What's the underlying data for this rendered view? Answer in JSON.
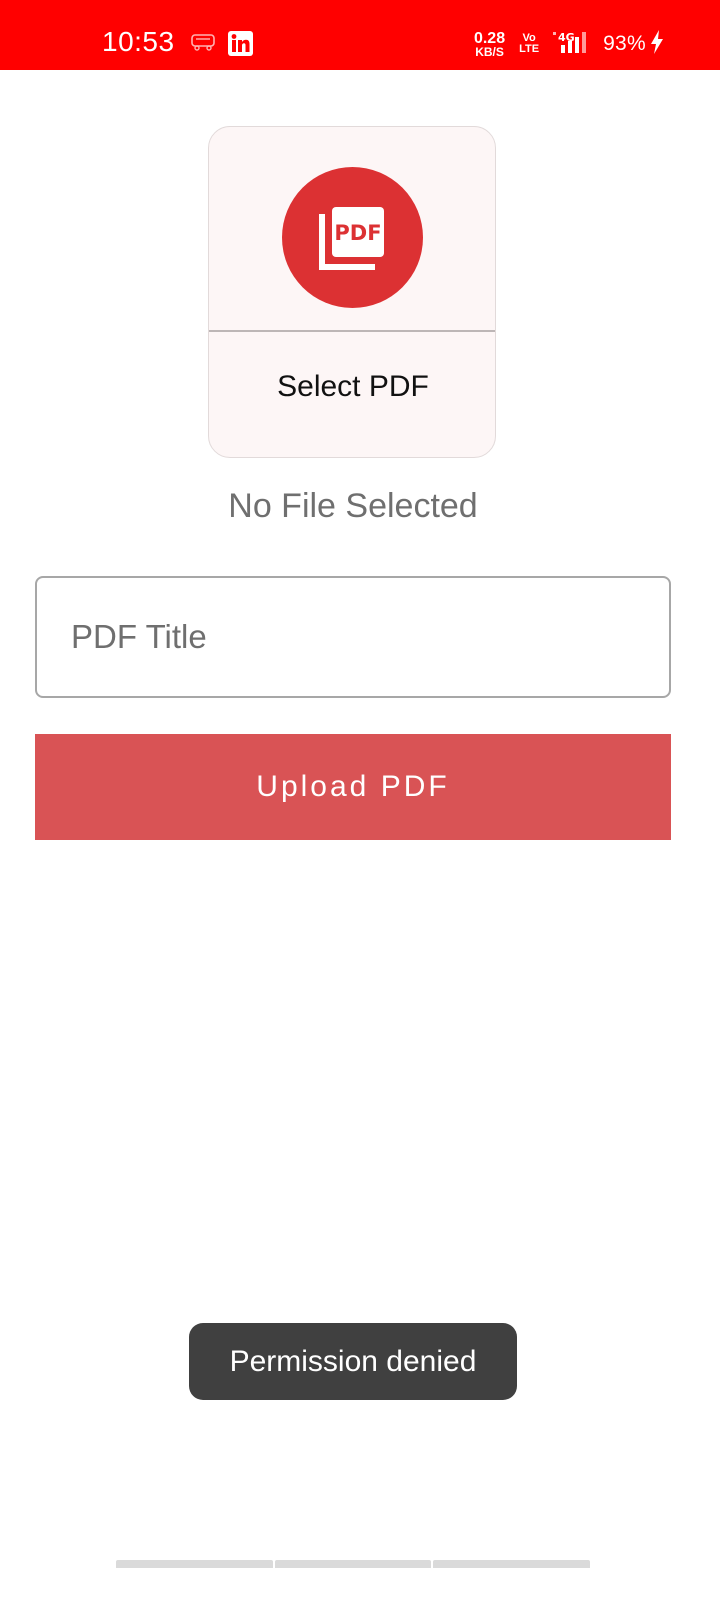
{
  "status_bar": {
    "time": "10:53",
    "net_speed_value": "0.28",
    "net_speed_unit": "KB/S",
    "volte_top": "Vo",
    "volte_bottom": "LTE",
    "network": "4G",
    "battery": "93%",
    "notification_icons": [
      "car-notification-icon",
      "linkedin-icon"
    ],
    "background_color": "#ff0000"
  },
  "pdf_picker": {
    "label": "Select PDF",
    "icon": "pdf-icon",
    "icon_text": "PDF",
    "accent_color": "#dc3133"
  },
  "file_status": "No File Selected",
  "title_input": {
    "placeholder": "PDF Title",
    "value": ""
  },
  "upload_button": {
    "label": "Upload PDF",
    "color": "#d95355"
  },
  "toast": {
    "message": "Permission denied"
  }
}
